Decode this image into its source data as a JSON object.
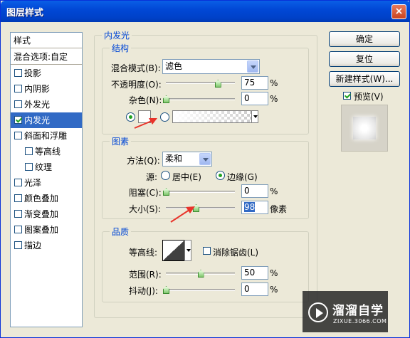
{
  "window": {
    "title": "图层样式",
    "close_glyph": "×"
  },
  "style_list": {
    "header": "样式",
    "blend_options": "混合选项:自定",
    "items": [
      {
        "label": "投影",
        "checked": false
      },
      {
        "label": "内阴影",
        "checked": false
      },
      {
        "label": "外发光",
        "checked": false
      },
      {
        "label": "内发光",
        "checked": true
      },
      {
        "label": "斜面和浮雕",
        "checked": false
      },
      {
        "label": "等高线",
        "checked": false
      },
      {
        "label": "纹理",
        "checked": false
      },
      {
        "label": "光泽",
        "checked": false
      },
      {
        "label": "颜色叠加",
        "checked": false
      },
      {
        "label": "渐变叠加",
        "checked": false
      },
      {
        "label": "图案叠加",
        "checked": false
      },
      {
        "label": "描边",
        "checked": false
      }
    ]
  },
  "inner_glow": {
    "title": "内发光",
    "structure": {
      "title": "结构",
      "blend_mode_label": "混合模式(B):",
      "blend_mode_value": "滤色",
      "opacity_label": "不透明度(O):",
      "opacity_value": "75",
      "opacity_level": 0.75,
      "noise_label": "杂色(N):",
      "noise_value": "0",
      "noise_level": 0,
      "percent": "%"
    },
    "elements": {
      "title": "图素",
      "method_label": "方法(Q):",
      "method_value": "柔和",
      "source_label": "源:",
      "source_center": "居中(E)",
      "source_edge": "边缘(G)",
      "choke_label": "阻塞(C):",
      "choke_value": "0",
      "choke_level": 0,
      "size_label": "大小(S):",
      "size_value": "98",
      "size_unit": "像素",
      "percent": "%"
    },
    "quality": {
      "title": "品质",
      "contour_label": "等高线:",
      "antialias_label": "消除锯齿(L)",
      "range_label": "范围(R):",
      "range_value": "50",
      "range_level": 0.5,
      "jitter_label": "抖动(J):",
      "jitter_value": "0",
      "jitter_level": 0,
      "percent": "%"
    }
  },
  "buttons": {
    "ok": "确定",
    "reset": "复位",
    "new_style": "新建样式(W)...",
    "preview_label": "预览(V)"
  },
  "watermark": {
    "title": "溜溜自学",
    "subtitle": "ZIXUE.3066.COM"
  },
  "colors": {
    "accent": "#316ac5",
    "title_bar": "#0148d6",
    "arrow": "#e8332a",
    "group_label": "#0046d5"
  }
}
